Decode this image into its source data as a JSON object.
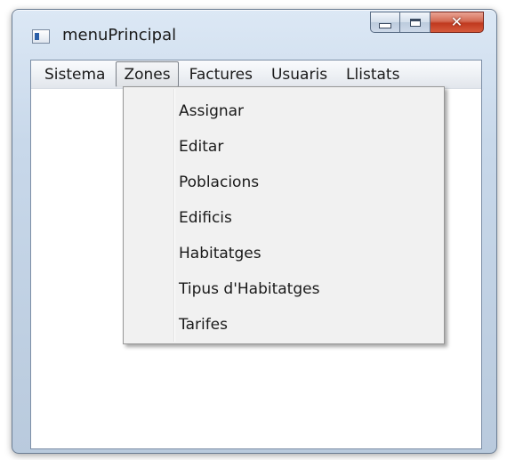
{
  "window": {
    "title": "menuPrincipal",
    "minimize_icon": "minimize-icon",
    "maximize_icon": "maximize-icon",
    "close_icon": "close-icon",
    "close_glyph": "✕"
  },
  "menubar": {
    "items": [
      {
        "label": "Sistema",
        "open": false
      },
      {
        "label": "Zones",
        "open": true
      },
      {
        "label": "Factures",
        "open": false
      },
      {
        "label": "Usuaris",
        "open": false
      },
      {
        "label": "Llistats",
        "open": false
      }
    ]
  },
  "zones_menu": {
    "items": [
      {
        "label": "Assignar"
      },
      {
        "label": "Editar"
      },
      {
        "label": "Poblacions"
      },
      {
        "label": "Edificis"
      },
      {
        "label": "Habitatges"
      },
      {
        "label": "Tipus d'Habitatges"
      },
      {
        "label": "Tarifes"
      }
    ]
  },
  "colors": {
    "close_button": "#c0391f",
    "menu_background": "#f1f1f1"
  }
}
